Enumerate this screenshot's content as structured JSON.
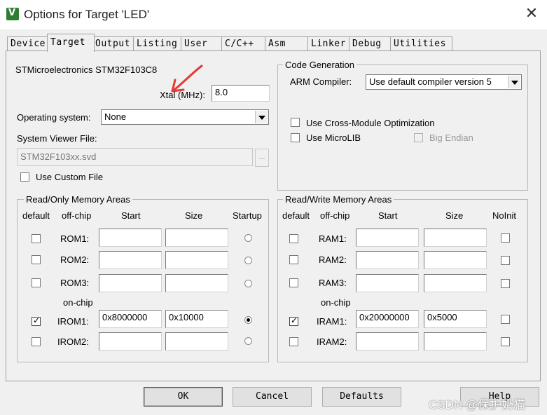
{
  "window": {
    "title": "Options for Target 'LED'",
    "close_glyph": "✕"
  },
  "tabs": [
    {
      "label": "Device"
    },
    {
      "label": "Target"
    },
    {
      "label": "Output"
    },
    {
      "label": "Listing"
    },
    {
      "label": "User"
    },
    {
      "label": "C/C++"
    },
    {
      "label": "Asm"
    },
    {
      "label": "Linker"
    },
    {
      "label": "Debug"
    },
    {
      "label": "Utilities"
    }
  ],
  "device_name": "STMicroelectronics STM32F103C8",
  "xtal": {
    "label": "Xtal (MHz):",
    "value": "8.0"
  },
  "os": {
    "label": "Operating system:",
    "value": "None"
  },
  "svd": {
    "label": "System Viewer File:",
    "value": "STM32F103xx.svd",
    "browse": "..."
  },
  "custom_file": {
    "label": "Use Custom File",
    "checked": false
  },
  "code_gen": {
    "title": "Code Generation",
    "compiler_label": "ARM Compiler:",
    "compiler_value": "Use default compiler version 5",
    "cross_module": "Use Cross-Module Optimization",
    "microlib": "Use MicroLIB",
    "big_endian": "Big Endian"
  },
  "ro_memory": {
    "title": "Read/Only Memory Areas",
    "headers": {
      "default": "default",
      "offchip": "off-chip",
      "start": "Start",
      "size": "Size",
      "last": "Startup"
    },
    "onchip_label": "on-chip",
    "rows": [
      {
        "name": "ROM1:",
        "start": "",
        "size": "",
        "default": false,
        "selected": false
      },
      {
        "name": "ROM2:",
        "start": "",
        "size": "",
        "default": false,
        "selected": false
      },
      {
        "name": "ROM3:",
        "start": "",
        "size": "",
        "default": false,
        "selected": false
      },
      {
        "name": "IROM1:",
        "start": "0x8000000",
        "size": "0x10000",
        "default": true,
        "selected": true
      },
      {
        "name": "IROM2:",
        "start": "",
        "size": "",
        "default": false,
        "selected": false
      }
    ]
  },
  "rw_memory": {
    "title": "Read/Write Memory Areas",
    "headers": {
      "default": "default",
      "offchip": "off-chip",
      "start": "Start",
      "size": "Size",
      "last": "NoInit"
    },
    "onchip_label": "on-chip",
    "rows": [
      {
        "name": "RAM1:",
        "start": "",
        "size": "",
        "default": false
      },
      {
        "name": "RAM2:",
        "start": "",
        "size": "",
        "default": false
      },
      {
        "name": "RAM3:",
        "start": "",
        "size": "",
        "default": false
      },
      {
        "name": "IRAM1:",
        "start": "0x20000000",
        "size": "0x5000",
        "default": true
      },
      {
        "name": "IRAM2:",
        "start": "",
        "size": "",
        "default": false
      }
    ]
  },
  "buttons": {
    "ok": "OK",
    "cancel": "Cancel",
    "defaults": "Defaults",
    "help": "Help"
  },
  "watermark": "CSDN @保护奶猫",
  "colors": {
    "annotation_arrow": "#e53935",
    "app_icon": "#2e7d32"
  }
}
